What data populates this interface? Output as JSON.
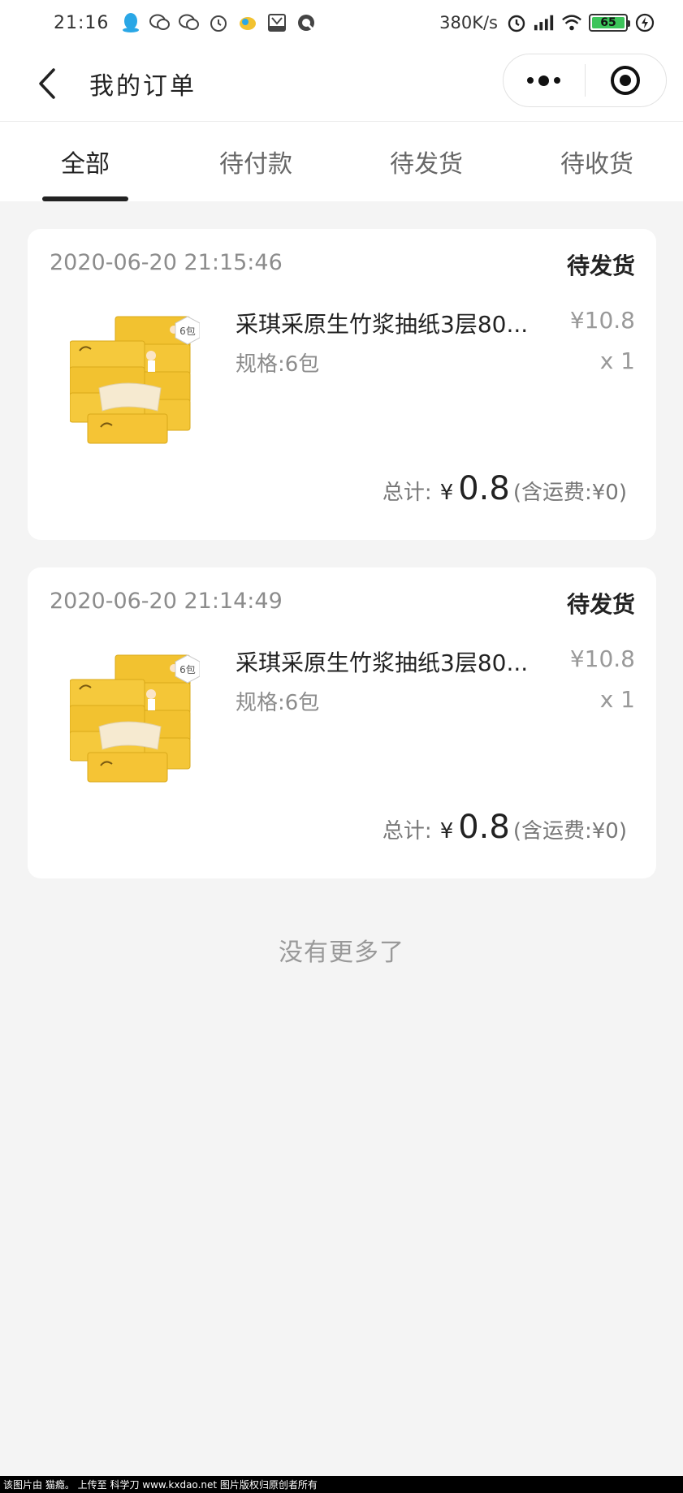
{
  "status_bar": {
    "time": "21:16",
    "network_speed": "380K/s",
    "battery_level": "65",
    "icons": [
      "qq-icon",
      "wechat-icon",
      "wechat-icon",
      "alarm-icon",
      "app-icon",
      "gallery-icon",
      "browser-icon"
    ]
  },
  "nav": {
    "title": "我的订单"
  },
  "tabs": [
    {
      "label": "全部",
      "active": true
    },
    {
      "label": "待付款",
      "active": false
    },
    {
      "label": "待发货",
      "active": false
    },
    {
      "label": "待收货",
      "active": false
    }
  ],
  "orders": [
    {
      "time": "2020-06-20 21:15:46",
      "status": "待发货",
      "product": {
        "name": "采琪采原生竹浆抽纸3层80...",
        "price": "¥10.8",
        "spec": "规格:6包",
        "qty": "x 1",
        "badge": "6包"
      },
      "total_label": "总计:",
      "currency": "¥",
      "total_amount": "0.8",
      "shipping_note": "(含运费:¥0)"
    },
    {
      "time": "2020-06-20 21:14:49",
      "status": "待发货",
      "product": {
        "name": "采琪采原生竹浆抽纸3层80...",
        "price": "¥10.8",
        "spec": "规格:6包",
        "qty": "x 1",
        "badge": "6包"
      },
      "total_label": "总计:",
      "currency": "¥",
      "total_amount": "0.8",
      "shipping_note": "(含运费:¥0)"
    }
  ],
  "footer_message": "没有更多了",
  "watermark": "该图片由 猫瘾。 上传至 科学刀 www.kxdao.net 图片版权归原创者所有",
  "colors": {
    "background": "#f4f4f4",
    "card": "#ffffff",
    "tab_indicator": "#222222",
    "product_yellow": "#f2c230",
    "battery_green": "#3cc45a"
  }
}
